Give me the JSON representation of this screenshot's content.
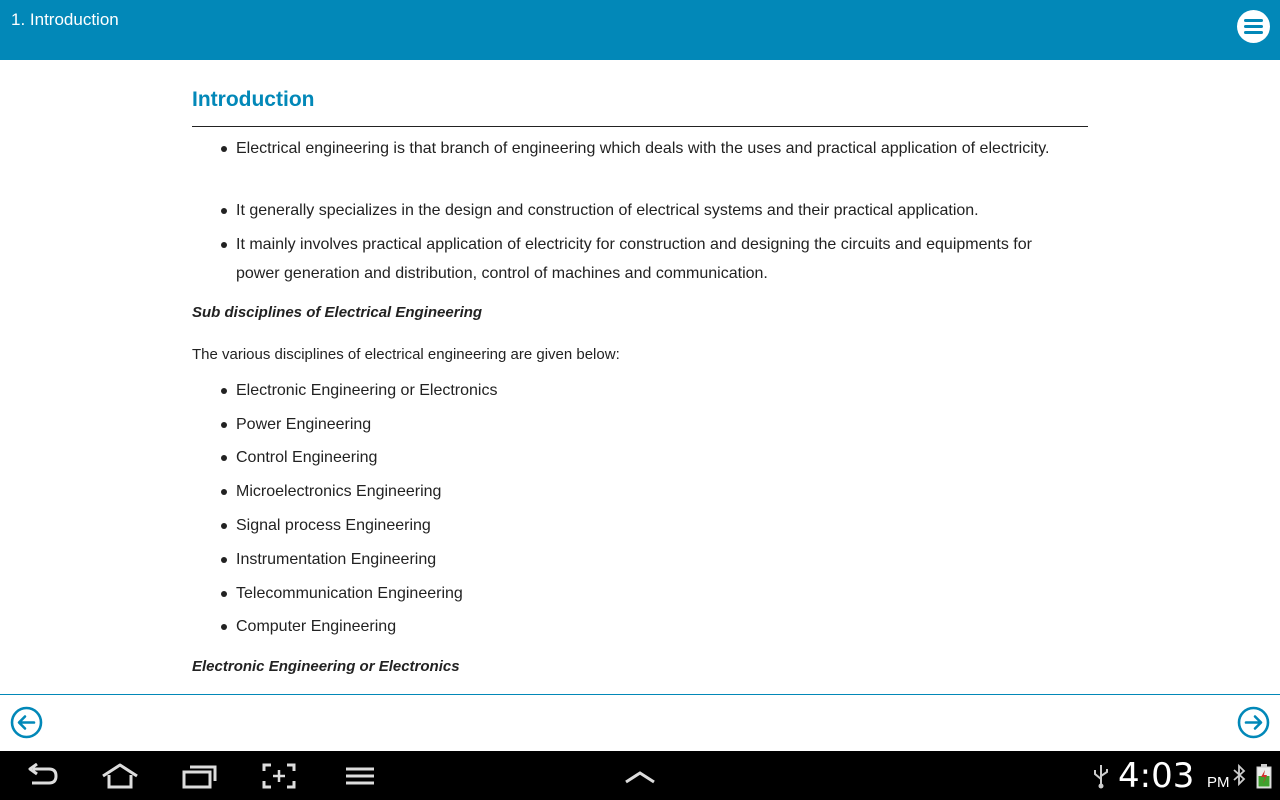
{
  "appbar": {
    "title": "1. Introduction",
    "menu_icon": "menu-icon"
  },
  "content": {
    "heading": "Introduction",
    "intro_bullets": [
      "Electrical engineering is that branch of engineering which deals with the uses and practical application of electricity.",
      "It generally specializes in the design and construction of electrical systems and their practical application.",
      "It mainly involves practical application of electricity for construction and designing the circuits and equipments for power generation and distribution, control of machines and communication."
    ],
    "subheading_1": "Sub disciplines of Electrical Engineering",
    "paragraph_1": "The various disciplines of electrical engineering are given below:",
    "disciplines": [
      "Electronic Engineering or Electronics",
      "Power Engineering",
      "Control Engineering",
      "Microelectronics Engineering",
      "Signal process Engineering",
      "Instrumentation Engineering",
      "Telecommunication Engineering",
      "Computer Engineering"
    ],
    "subheading_2": "Electronic Engineering or Electronics"
  },
  "navigation": {
    "prev_icon": "arrow-left-circle-icon",
    "next_icon": "arrow-right-circle-icon"
  },
  "system_bar": {
    "time": "4:03",
    "ampm": "PM",
    "icons": [
      "back-icon",
      "home-icon",
      "recent-apps-icon",
      "screenshot-icon",
      "menu-icon",
      "chevron-up-icon",
      "usb-icon",
      "bluetooth-icon",
      "battery-icon"
    ]
  },
  "colors": {
    "accent": "#0288b8",
    "text": "#222222",
    "system_bar": "#000000"
  }
}
